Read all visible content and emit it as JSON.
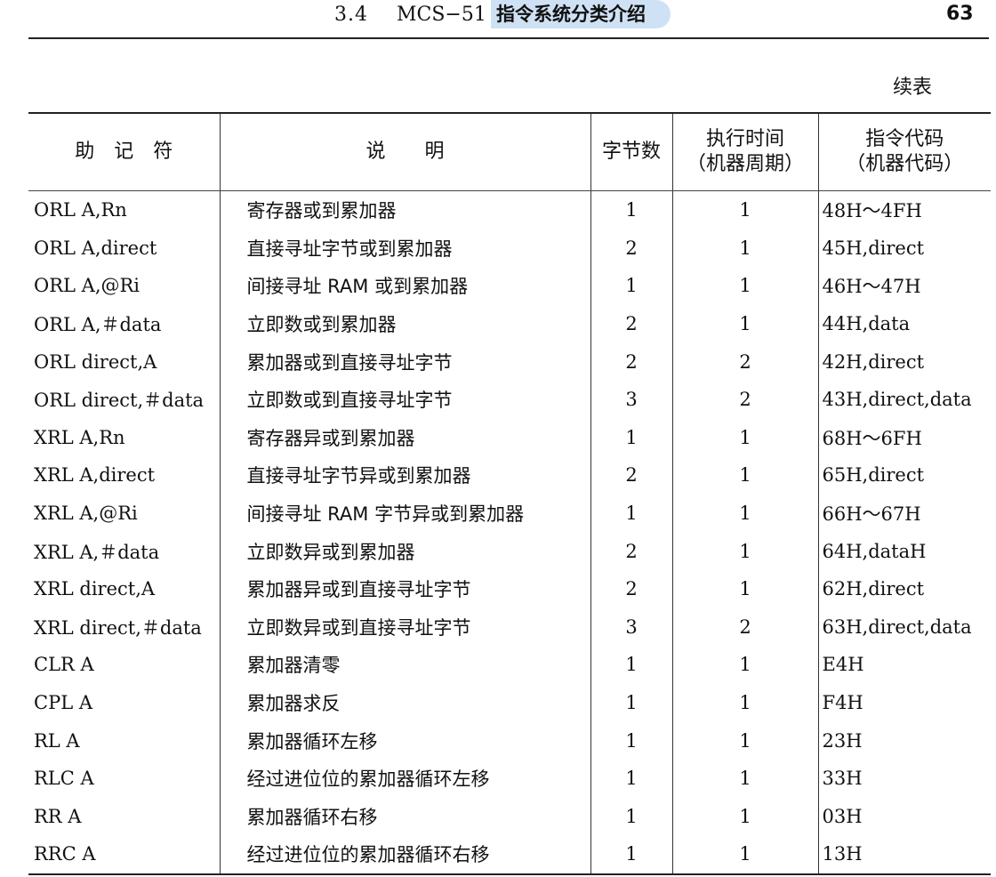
{
  "header": {
    "section_number": "3.4",
    "section_title_en": "MCS−51",
    "section_title_highlight": "指令系统分类介绍",
    "page_number": "63"
  },
  "continued_label": "续表",
  "table": {
    "columns": [
      "助　记　符",
      "说　　明",
      "字节数",
      "执行时间\n（机器周期）",
      "指令代码\n（机器代码）"
    ],
    "rows": [
      [
        "ORL A,Rn",
        "寄存器或到累加器",
        "1",
        "1",
        "48H～4FH"
      ],
      [
        "ORL A,direct",
        "直接寻址字节或到累加器",
        "2",
        "1",
        "45H,direct"
      ],
      [
        "ORL A,@Ri",
        "间接寻址 RAM 或到累加器",
        "1",
        "1",
        "46H～47H"
      ],
      [
        "ORL A,＃data",
        "立即数或到累加器",
        "2",
        "1",
        "44H,data"
      ],
      [
        "ORL direct,A",
        "累加器或到直接寻址字节",
        "2",
        "2",
        "42H,direct"
      ],
      [
        "ORL direct,＃data",
        "立即数或到直接寻址字节",
        "3",
        "2",
        "43H,direct,data"
      ],
      [
        "XRL A,Rn",
        "寄存器异或到累加器",
        "1",
        "1",
        "68H～6FH"
      ],
      [
        "XRL A,direct",
        "直接寻址字节异或到累加器",
        "2",
        "1",
        "65H,direct"
      ],
      [
        "XRL A,@Ri",
        "间接寻址 RAM 字节异或到累加器",
        "1",
        "1",
        "66H～67H"
      ],
      [
        "XRL A,＃data",
        "立即数异或到累加器",
        "2",
        "1",
        "64H,dataH"
      ],
      [
        "XRL direct,A",
        "累加器异或到直接寻址字节",
        "2",
        "1",
        "62H,direct"
      ],
      [
        "XRL direct,＃data",
        "立即数异或到直接寻址字节",
        "3",
        "2",
        "63H,direct,data"
      ],
      [
        "CLR A",
        "累加器清零",
        "1",
        "1",
        "E4H"
      ],
      [
        "CPL A",
        "累加器求反",
        "1",
        "1",
        "F4H"
      ],
      [
        "RL A",
        "累加器循环左移",
        "1",
        "1",
        "23H"
      ],
      [
        "RLC A",
        "经过进位位的累加器循环左移",
        "1",
        "1",
        "33H"
      ],
      [
        "RR A",
        "累加器循环右移",
        "1",
        "1",
        "03H"
      ],
      [
        "RRC A",
        "经过进位位的累加器循环右移",
        "1",
        "1",
        "13H"
      ]
    ]
  }
}
